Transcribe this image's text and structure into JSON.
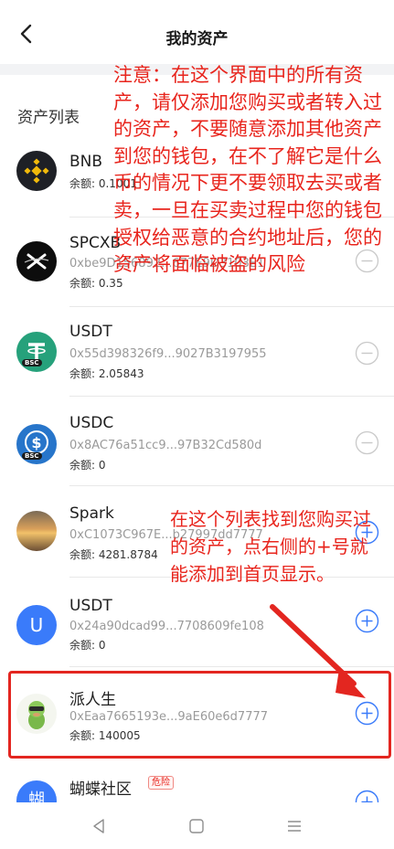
{
  "header": {
    "title": "我的资产"
  },
  "section": {
    "label": "资产列表"
  },
  "annotations": {
    "top_note": "注意：在这个界面中的所有资产，请仅添加您购买或者转入过的资产，不要随意添加其他资产到您的钱包，在不了解它是什么币的情况下更不要领取去买或者卖，一旦在买卖过程中您的钱包授权给恶意的合约地址后，您的资产将面临被盗的风险",
    "mid_note": "在这个列表找到您购买过的资产，点右侧的+号就能添加到首页显示。"
  },
  "assets": [
    {
      "name": "BNB",
      "address": "",
      "balance": "余额: 0.1001",
      "action": "remove"
    },
    {
      "name": "SPCXB",
      "address": "0xbe9D156892...677E9D3103E1",
      "balance": "余额: 0.35",
      "action": "remove"
    },
    {
      "name": "USDT",
      "address": "0x55d398326f9...9027B3197955",
      "balance": "余额: 2.05843",
      "action": "remove",
      "chain_tag": "BSC"
    },
    {
      "name": "USDC",
      "address": "0x8AC76a51cc9...97B32Cd580d",
      "balance": "余额: 0",
      "action": "remove",
      "chain_tag": "BSC"
    },
    {
      "name": "Spark",
      "address": "0xC1073C967E...b27997dd7777",
      "balance": "余额: 4281.8784",
      "action": "add"
    },
    {
      "name": "USDT",
      "address": "0x24a90dcad99...7708609fe108",
      "balance": "余额: 0",
      "action": "add",
      "avatar_letter": "U"
    },
    {
      "name": "派人生",
      "address": "0xEaa7665193e...9aE60e6d7777",
      "balance": "余额: 140005",
      "action": "add"
    },
    {
      "name": "蝴蝶社区",
      "address": "",
      "balance": "",
      "action": "add",
      "badge": "危险",
      "avatar_letter": "蝴"
    }
  ],
  "colors": {
    "accent": "#3a7bfa",
    "warning": "#e8251d",
    "muted": "#9a9a9a",
    "bnb": "#f0b90b",
    "usdt": "#26a17b",
    "usdc": "#2775ca"
  },
  "icons": {
    "back": "chevron-left-icon",
    "remove": "minus-circle-icon",
    "add": "plus-circle-icon",
    "nav_back": "triangle-back-icon",
    "nav_home": "square-home-icon",
    "nav_menu": "menu-lines-icon"
  }
}
